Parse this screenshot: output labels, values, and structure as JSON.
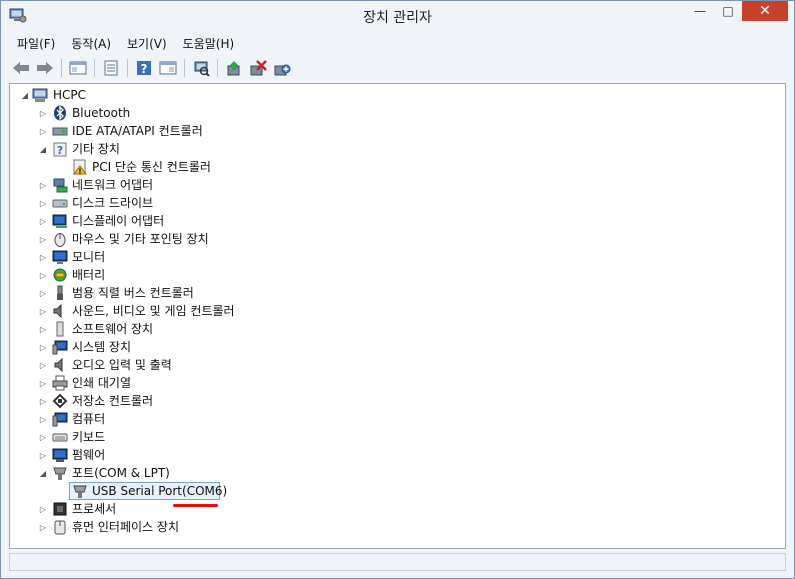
{
  "window": {
    "title": "장치 관리자"
  },
  "controls": {
    "minimize": "—",
    "maximize": "□",
    "close": "✕"
  },
  "menu": [
    {
      "label": "파일(F)"
    },
    {
      "label": "동작(A)"
    },
    {
      "label": "보기(V)"
    },
    {
      "label": "도움말(H)"
    }
  ],
  "toolbar": [
    {
      "icon": "back-arrow-icon"
    },
    {
      "icon": "forward-arrow-icon"
    },
    {
      "icon": "properties-pane-icon"
    },
    {
      "icon": "list-view-icon"
    },
    {
      "icon": "help-icon"
    },
    {
      "icon": "action-pane-icon"
    },
    {
      "icon": "scan-hardware-icon"
    },
    {
      "icon": "update-driver-icon"
    },
    {
      "icon": "uninstall-device-icon"
    },
    {
      "icon": "add-legacy-hardware-icon"
    }
  ],
  "tree": {
    "root": {
      "label": "HCPC",
      "icon": "computer-icon",
      "expanded": true
    },
    "items": [
      {
        "label": "Bluetooth",
        "icon": "bluetooth-icon",
        "expanded": false
      },
      {
        "label": "IDE ATA/ATAPI 컨트롤러",
        "icon": "ide-controller-icon",
        "expanded": false
      },
      {
        "label": "기타 장치",
        "icon": "unknown-device-icon",
        "expanded": true,
        "children": [
          {
            "label": "PCI 단순 통신 컨트롤러",
            "icon": "warning-device-icon"
          }
        ]
      },
      {
        "label": "네트워크 어댑터",
        "icon": "network-adapter-icon",
        "expanded": false
      },
      {
        "label": "디스크 드라이브",
        "icon": "disk-drive-icon",
        "expanded": false
      },
      {
        "label": "디스플레이 어댑터",
        "icon": "display-adapter-icon",
        "expanded": false
      },
      {
        "label": "마우스 및 기타 포인팅 장치",
        "icon": "mouse-icon",
        "expanded": false
      },
      {
        "label": "모니터",
        "icon": "monitor-icon",
        "expanded": false
      },
      {
        "label": "배터리",
        "icon": "battery-icon",
        "expanded": false
      },
      {
        "label": "범용 직렬 버스 컨트롤러",
        "icon": "usb-controller-icon",
        "expanded": false
      },
      {
        "label": "사운드, 비디오 및 게임 컨트롤러",
        "icon": "sound-icon",
        "expanded": false
      },
      {
        "label": "소프트웨어 장치",
        "icon": "software-device-icon",
        "expanded": false
      },
      {
        "label": "시스템 장치",
        "icon": "system-device-icon",
        "expanded": false
      },
      {
        "label": "오디오 입력 및 출력",
        "icon": "audio-io-icon",
        "expanded": false
      },
      {
        "label": "인쇄 대기열",
        "icon": "printer-icon",
        "expanded": false
      },
      {
        "label": "저장소 컨트롤러",
        "icon": "storage-controller-icon",
        "expanded": false
      },
      {
        "label": "컴퓨터",
        "icon": "computer-category-icon",
        "expanded": false
      },
      {
        "label": "키보드",
        "icon": "keyboard-icon",
        "expanded": false
      },
      {
        "label": "펌웨어",
        "icon": "firmware-icon",
        "expanded": false
      },
      {
        "label": "포트(COM & LPT)",
        "icon": "port-icon",
        "expanded": true,
        "children": [
          {
            "label": "USB Serial Port(COM6)",
            "icon": "serial-port-icon",
            "selected": true
          }
        ]
      },
      {
        "label": "프로세서",
        "icon": "processor-icon",
        "expanded": false
      },
      {
        "label": "휴먼 인터페이스 장치",
        "icon": "hid-icon",
        "expanded": false
      }
    ]
  },
  "colors": {
    "accent": "#7da2ce",
    "close": "#c7402a",
    "annotation": "#e01010"
  }
}
